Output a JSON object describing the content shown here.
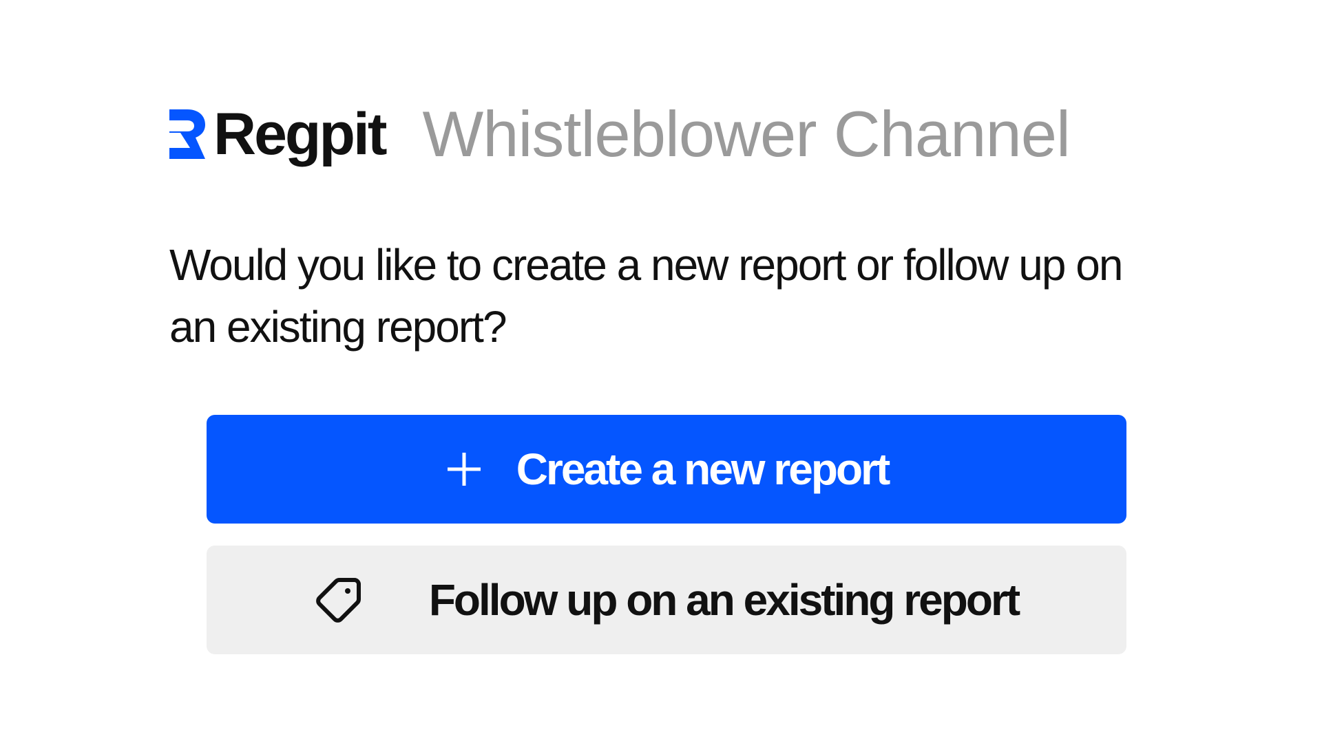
{
  "header": {
    "brand_name": "Regpit",
    "brand_mark_icon": "regpit-logo-mark",
    "channel_title": "Whistleblower Channel"
  },
  "question": {
    "text": "Would you like to create a new report or follow up on an existing report?"
  },
  "actions": {
    "create": {
      "label": "Create a new report",
      "icon": "plus-icon"
    },
    "follow_up": {
      "label": "Follow up on an existing report",
      "icon": "tag-icon"
    }
  },
  "colors": {
    "brand_blue": "#0556ff",
    "text_dark": "#111111",
    "title_gray": "#9a9a9a",
    "secondary_button_bg": "#efefef"
  }
}
